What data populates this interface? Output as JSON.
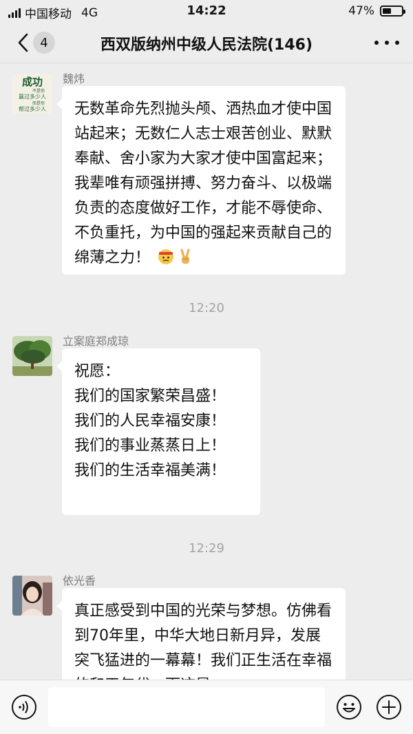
{
  "status_bar": {
    "carrier": "中国移动",
    "network": "4G",
    "time": "14:22",
    "battery": "47%",
    "battery_level": 0.47
  },
  "header": {
    "unread_count": "4",
    "title": "西双版纳州中级人民法院(146)"
  },
  "messages": [
    {
      "sender": "魏炜",
      "avatar_text": [
        "成功",
        "不是你",
        "赢过多少人",
        "而是你",
        "帮过多少人"
      ],
      "text": "无数革命先烈抛头颅、洒热血才使中国站起来；无数仁人志士艰苦创业、默默奉献、舍小家为大家才使中国富起来；我辈唯有顽强拼搏、努力奋斗、以极端负责的态度做好工作，才能不辱使命、不负重托，为中国的强起来贡献自己的绵薄之力！",
      "emojis": [
        "determined-face-emoji",
        "victory-hand-emoji"
      ]
    },
    {
      "time": "12:20"
    },
    {
      "sender": "立案庭郑成琼",
      "lines": [
        "祝愿：",
        "我们的国家繁荣昌盛！",
        "我们的人民幸福安康！",
        "我们的事业蒸蒸日上！",
        "我们的生活幸福美满！"
      ]
    },
    {
      "time": "12:29"
    },
    {
      "sender": "依光香",
      "text": "真正感受到中国的光荣与梦想。仿佛看到70年里，中华大地日新月异，发展突飞猛进的一幕幕！我们正生活在幸福的和平年代，而这是"
    }
  ],
  "input_bar": {
    "icons": [
      "voice-icon",
      "emoji-icon",
      "plus-icon"
    ],
    "placeholder": ""
  },
  "colors": {
    "background": "#ededed",
    "bubble": "#ffffff",
    "meta_text": "#a3a3a3"
  }
}
